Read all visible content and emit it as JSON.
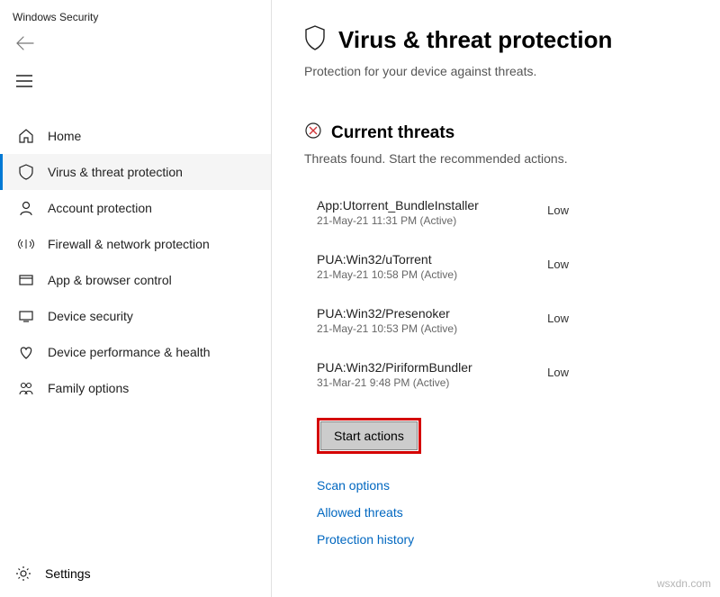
{
  "app": {
    "title": "Windows Security"
  },
  "sidebar": {
    "items": [
      {
        "label": "Home"
      },
      {
        "label": "Virus & threat protection"
      },
      {
        "label": "Account protection"
      },
      {
        "label": "Firewall & network protection"
      },
      {
        "label": "App & browser control"
      },
      {
        "label": "Device security"
      },
      {
        "label": "Device performance & health"
      },
      {
        "label": "Family options"
      }
    ],
    "settings_label": "Settings"
  },
  "page": {
    "title": "Virus & threat protection",
    "subtitle": "Protection for your device against threats."
  },
  "current_threats": {
    "heading": "Current threats",
    "subtitle": "Threats found. Start the recommended actions.",
    "items": [
      {
        "name": "App:Utorrent_BundleInstaller",
        "timestamp": "21-May-21 11:31 PM",
        "status": "(Active)",
        "severity": "Low"
      },
      {
        "name": "PUA:Win32/uTorrent",
        "timestamp": "21-May-21 10:58 PM",
        "status": "(Active)",
        "severity": "Low"
      },
      {
        "name": "PUA:Win32/Presenoker",
        "timestamp": "21-May-21 10:53 PM",
        "status": "(Active)",
        "severity": "Low"
      },
      {
        "name": "PUA:Win32/PiriformBundler",
        "timestamp": "31-Mar-21 9:48 PM",
        "status": "(Active)",
        "severity": "Low"
      }
    ],
    "start_button": "Start actions",
    "links": {
      "scan": "Scan options",
      "allowed": "Allowed threats",
      "history": "Protection history"
    }
  },
  "watermark": "wsxdn.com"
}
